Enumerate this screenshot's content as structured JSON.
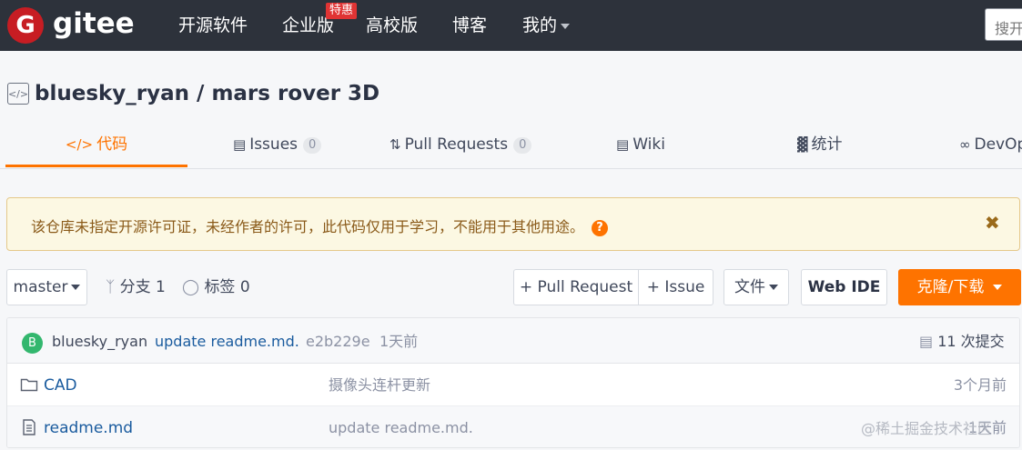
{
  "navbar": {
    "logo_letter": "G",
    "logo_text": "gitee",
    "items": [
      {
        "label": "开源软件"
      },
      {
        "label": "企业版"
      },
      {
        "label": "高校版"
      },
      {
        "label": "博客"
      },
      {
        "label": "我的"
      }
    ],
    "promo_badge": "特惠",
    "search_placeholder": "搜开源"
  },
  "repo": {
    "title": "bluesky_ryan / mars rover 3D",
    "icon": "code-icon"
  },
  "tabs": [
    {
      "label": "代码",
      "icon": "</>",
      "active": true
    },
    {
      "label": "Issues",
      "count": "0"
    },
    {
      "label": "Pull Requests",
      "count": "0"
    },
    {
      "label": "Wiki"
    },
    {
      "label": "统计"
    },
    {
      "label": "DevOps"
    }
  ],
  "notice": {
    "text": "该仓库未指定开源许可证，未经作者的许可，此代码仅用于学习，不能用于其他用途。",
    "help": "?",
    "close": "✖"
  },
  "toolbar": {
    "branch": "master",
    "branches": "分支 1",
    "tags": "标签 0",
    "pull_request": "+ Pull Request",
    "issue": "+ Issue",
    "file": "文件",
    "web_ide": "Web IDE",
    "clone": "克隆/下载"
  },
  "commit": {
    "avatar_letter": "B",
    "author": "bluesky_ryan",
    "message": "update readme.md.",
    "hash": "e2b229e",
    "time": "1天前",
    "count": "11 次提交"
  },
  "files": [
    {
      "type": "folder",
      "name": "CAD",
      "message": "摄像头连杆更新",
      "time": "3个月前"
    },
    {
      "type": "file",
      "name": "readme.md",
      "message": "update readme.md.",
      "time": "1天前"
    }
  ],
  "watermark": "@稀土掘金技术社区",
  "colors": {
    "accent": "#fe7300",
    "navbar": "#2d323b",
    "brand": "#c71d23"
  }
}
